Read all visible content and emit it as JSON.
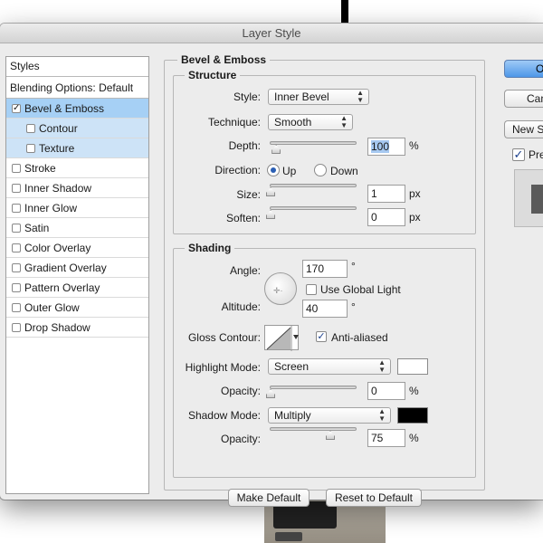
{
  "dialog": {
    "title": "Layer Style"
  },
  "sidebar": {
    "header": "Styles",
    "blending_options": "Blending Options: Default",
    "items": [
      {
        "label": "Bevel & Emboss",
        "checked": true,
        "selected": true
      },
      {
        "label": "Contour",
        "checked": false,
        "sub": true
      },
      {
        "label": "Texture",
        "checked": false,
        "sub": true
      },
      {
        "label": "Stroke",
        "checked": false
      },
      {
        "label": "Inner Shadow",
        "checked": false
      },
      {
        "label": "Inner Glow",
        "checked": false
      },
      {
        "label": "Satin",
        "checked": false
      },
      {
        "label": "Color Overlay",
        "checked": false
      },
      {
        "label": "Gradient Overlay",
        "checked": false
      },
      {
        "label": "Pattern Overlay",
        "checked": false
      },
      {
        "label": "Outer Glow",
        "checked": false
      },
      {
        "label": "Drop Shadow",
        "checked": false
      }
    ]
  },
  "bevel": {
    "title": "Bevel & Emboss",
    "structure": {
      "title": "Structure",
      "style_label": "Style:",
      "style_value": "Inner Bevel",
      "technique_label": "Technique:",
      "technique_value": "Smooth",
      "depth_label": "Depth:",
      "depth_value": "100",
      "depth_unit": "%",
      "depth_level": 0.07,
      "direction_label": "Direction:",
      "direction_up": "Up",
      "direction_down": "Down",
      "direction_selected": "Up",
      "size_label": "Size:",
      "size_value": "1",
      "size_unit": "px",
      "size_level": 0.0,
      "soften_label": "Soften:",
      "soften_value": "0",
      "soften_unit": "px",
      "soften_level": 0.0
    },
    "shading": {
      "title": "Shading",
      "angle_label": "Angle:",
      "angle_value": "170",
      "angle_unit": "°",
      "global_light_label": "Use Global Light",
      "global_light_checked": false,
      "altitude_label": "Altitude:",
      "altitude_value": "40",
      "altitude_unit": "°",
      "gloss_contour_label": "Gloss Contour:",
      "anti_aliased_label": "Anti-aliased",
      "anti_aliased_checked": true,
      "highlight_mode_label": "Highlight Mode:",
      "highlight_mode_value": "Screen",
      "highlight_color": "#ffffff",
      "highlight_opacity_label": "Opacity:",
      "highlight_opacity_value": "0",
      "highlight_opacity_unit": "%",
      "highlight_opacity_level": 0.0,
      "shadow_mode_label": "Shadow Mode:",
      "shadow_mode_value": "Multiply",
      "shadow_color": "#000000",
      "shadow_opacity_label": "Opacity:",
      "shadow_opacity_value": "75",
      "shadow_opacity_unit": "%",
      "shadow_opacity_level": 0.75
    },
    "make_default": "Make Default",
    "reset_default": "Reset to Default"
  },
  "actions": {
    "ok": "OK",
    "cancel": "Cancel",
    "new_style": "New Style...",
    "preview_label": "Preview",
    "preview_checked": true
  }
}
